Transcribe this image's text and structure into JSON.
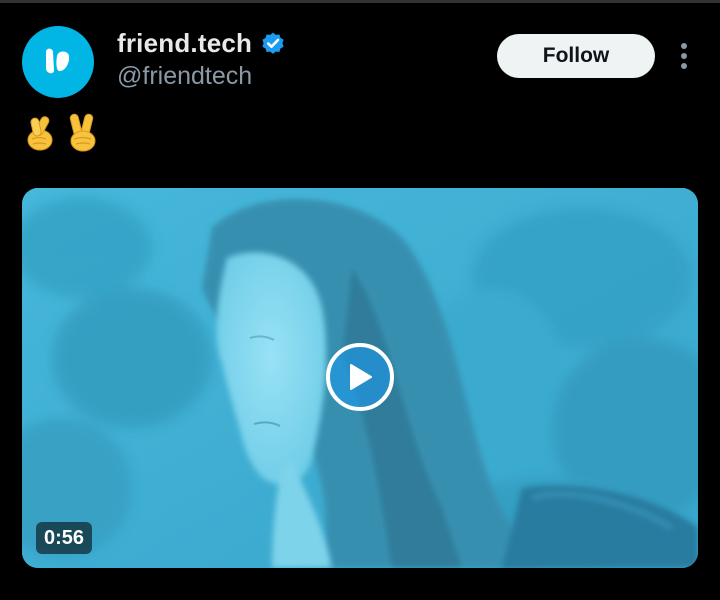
{
  "post": {
    "author": {
      "display_name": "friend.tech",
      "handle": "@friendtech",
      "verified": true,
      "avatar_icon": "friendtech-logo-icon",
      "avatar_color": "#01b5e4"
    },
    "follow_label": "Follow",
    "menu_icon": "more-vertical-icon",
    "text_emojis": [
      "🫰",
      "✌️"
    ],
    "media": {
      "type": "video",
      "duration": "0:56",
      "play_icon": "play-icon"
    }
  },
  "colors": {
    "background": "#000000",
    "verified_badge": "#1d9bf0",
    "follow_button_bg": "#eff3f4",
    "handle_text": "#8b98a5"
  }
}
